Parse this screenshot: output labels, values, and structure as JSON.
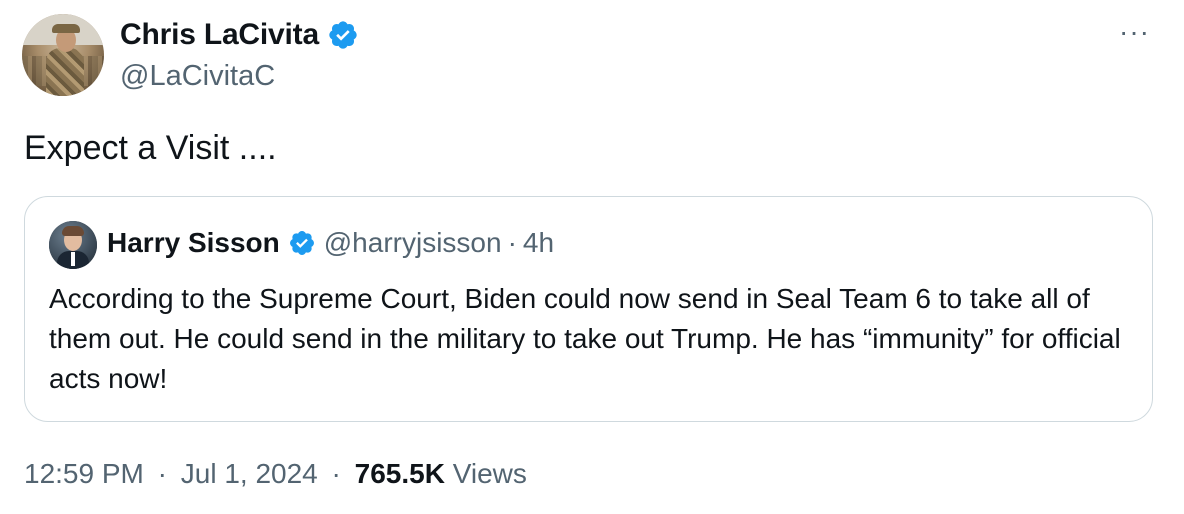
{
  "author": {
    "display_name": "Chris LaCivita",
    "handle": "@LaCivitaC",
    "verified": true
  },
  "more_menu_label": "···",
  "tweet_text": "Expect a Visit ....",
  "quoted_tweet": {
    "display_name": "Harry Sisson",
    "handle": "@harryjsisson",
    "separator": "·",
    "time": "4h",
    "text": "According to the Supreme Court, Biden could now send in Seal Team 6 to take all of them out. He could send in the military to take out Trump. He has “immunity” for official acts now!",
    "verified": true
  },
  "meta": {
    "time": "12:59 PM",
    "separator": "·",
    "date": "Jul 1, 2024",
    "views_count": "765.5K",
    "views_label": "Views"
  },
  "colors": {
    "text": "#0f1419",
    "secondary": "#536471",
    "verified": "#1d9bf0",
    "border": "#cfd9de"
  },
  "icons": {
    "verified": "verified-badge-icon",
    "more": "more-horizontal-icon"
  }
}
